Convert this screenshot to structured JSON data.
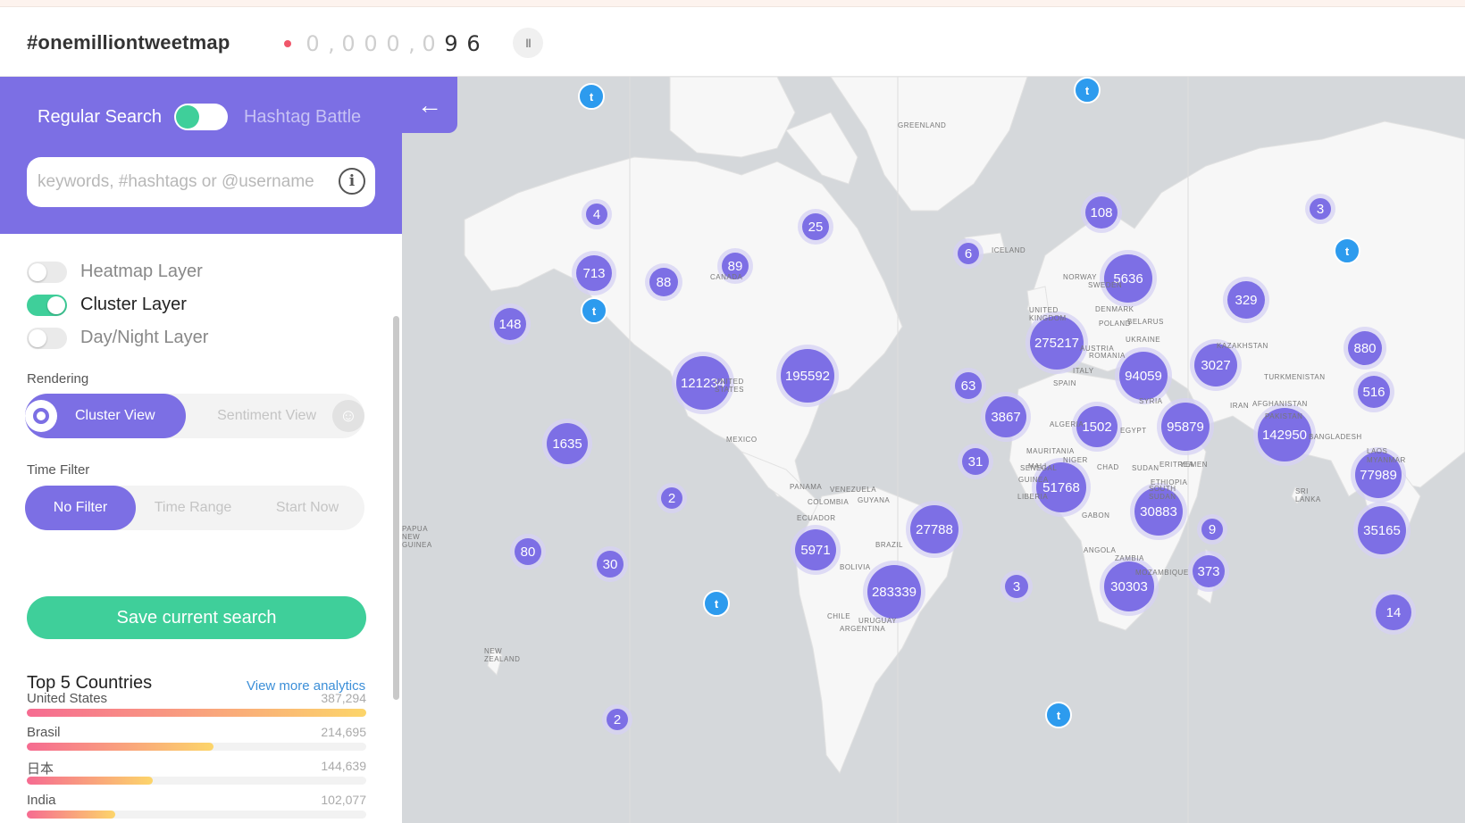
{
  "header": {
    "brand": "#onemilliontweetmap",
    "counter_digits": [
      "0",
      ",",
      "0",
      "0",
      "0",
      ",",
      "0",
      "9",
      "6"
    ],
    "pause_label": "II"
  },
  "sidebar": {
    "mode_left": "Regular Search",
    "mode_right": "Hashtag Battle",
    "search_placeholder": "keywords, #hashtags or @username",
    "search_value": "",
    "info_label": "i",
    "collapse_label": "←",
    "layers": [
      {
        "label": "Heatmap Layer",
        "on": false
      },
      {
        "label": "Cluster Layer",
        "on": true
      },
      {
        "label": "Day/Night Layer",
        "on": false
      }
    ],
    "rendering_label": "Rendering",
    "rendering_options": [
      "Cluster View",
      "Sentiment View"
    ],
    "time_filter_label": "Time Filter",
    "time_options": [
      "No Filter",
      "Time Range",
      "Start Now"
    ],
    "save_label": "Save current search",
    "top5_title": "Top 5 Countries",
    "view_more": "View more analytics",
    "countries": [
      {
        "name": "United States",
        "value": "387,294",
        "fraction": 1.0
      },
      {
        "name": "Brasil",
        "value": "214,695",
        "fraction": 0.55
      },
      {
        "name": "日本",
        "value": "144,639",
        "fraction": 0.37
      },
      {
        "name": "India",
        "value": "102,077",
        "fraction": 0.26
      }
    ]
  },
  "map": {
    "clusters": [
      "4",
      "25",
      "108",
      "3",
      "6",
      "713",
      "88",
      "89",
      "5636",
      "329",
      "148",
      "275217",
      "880",
      "3027",
      "121234",
      "195592",
      "63",
      "94059",
      "516",
      "3867",
      "1502",
      "95879",
      "142950",
      "1635",
      "31",
      "51768",
      "77989",
      "2",
      "30883",
      "9",
      "80",
      "30",
      "27788",
      "35165",
      "5971",
      "373",
      "283339",
      "3",
      "30303",
      "14",
      "2"
    ],
    "map_labels": [
      "GREENLAND",
      "ICELAND",
      "NORWAY",
      "SWEDEN",
      "DENMARK",
      "UNITED KINGDOM",
      "POLAND",
      "BELARUS",
      "UKRAINE",
      "KAZAKHSTAN",
      "AUSTRIA",
      "ROMANIA",
      "ITALY",
      "SPAIN",
      "SYRIA",
      "IRAN",
      "AFGHANISTAN",
      "PAKISTAN",
      "ALGERIA",
      "MAURITANIA",
      "MALI",
      "NIGER",
      "CHAD",
      "SUDAN",
      "EGYPT",
      "ERITREA",
      "YEMEN",
      "SENEGAL",
      "GUINEA",
      "LIBERIA",
      "ETHIOPIA",
      "SOUTH SUDAN",
      "GABON",
      "ANGOLA",
      "ZAMBIA",
      "MOZAMBIQUE",
      "SRI LANKA",
      "MYANMAR",
      "LAOS",
      "UNITED STATES",
      "MEXICO",
      "PANAMA",
      "COLOMBIA",
      "VENEZUELA",
      "GUYANA",
      "ECUADOR",
      "BRAZIL",
      "BOLIVIA",
      "CHILE",
      "ARGENTINA",
      "URUGUAY",
      "PAPUA NEW GUINEA",
      "NEW ZEALAND",
      "CANADA",
      "BANGLADESH",
      "TURKMENISTAN"
    ]
  }
}
